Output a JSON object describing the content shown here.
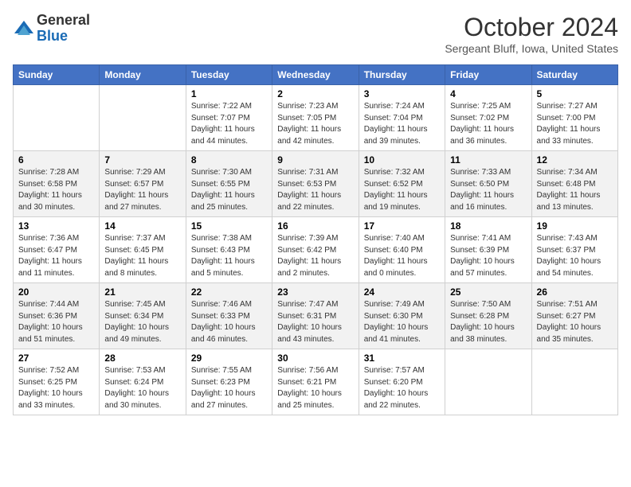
{
  "header": {
    "logo_general": "General",
    "logo_blue": "Blue",
    "month": "October 2024",
    "location": "Sergeant Bluff, Iowa, United States"
  },
  "weekdays": [
    "Sunday",
    "Monday",
    "Tuesday",
    "Wednesday",
    "Thursday",
    "Friday",
    "Saturday"
  ],
  "weeks": [
    [
      {
        "day": "",
        "detail": ""
      },
      {
        "day": "",
        "detail": ""
      },
      {
        "day": "1",
        "detail": "Sunrise: 7:22 AM\nSunset: 7:07 PM\nDaylight: 11 hours and 44 minutes."
      },
      {
        "day": "2",
        "detail": "Sunrise: 7:23 AM\nSunset: 7:05 PM\nDaylight: 11 hours and 42 minutes."
      },
      {
        "day": "3",
        "detail": "Sunrise: 7:24 AM\nSunset: 7:04 PM\nDaylight: 11 hours and 39 minutes."
      },
      {
        "day": "4",
        "detail": "Sunrise: 7:25 AM\nSunset: 7:02 PM\nDaylight: 11 hours and 36 minutes."
      },
      {
        "day": "5",
        "detail": "Sunrise: 7:27 AM\nSunset: 7:00 PM\nDaylight: 11 hours and 33 minutes."
      }
    ],
    [
      {
        "day": "6",
        "detail": "Sunrise: 7:28 AM\nSunset: 6:58 PM\nDaylight: 11 hours and 30 minutes."
      },
      {
        "day": "7",
        "detail": "Sunrise: 7:29 AM\nSunset: 6:57 PM\nDaylight: 11 hours and 27 minutes."
      },
      {
        "day": "8",
        "detail": "Sunrise: 7:30 AM\nSunset: 6:55 PM\nDaylight: 11 hours and 25 minutes."
      },
      {
        "day": "9",
        "detail": "Sunrise: 7:31 AM\nSunset: 6:53 PM\nDaylight: 11 hours and 22 minutes."
      },
      {
        "day": "10",
        "detail": "Sunrise: 7:32 AM\nSunset: 6:52 PM\nDaylight: 11 hours and 19 minutes."
      },
      {
        "day": "11",
        "detail": "Sunrise: 7:33 AM\nSunset: 6:50 PM\nDaylight: 11 hours and 16 minutes."
      },
      {
        "day": "12",
        "detail": "Sunrise: 7:34 AM\nSunset: 6:48 PM\nDaylight: 11 hours and 13 minutes."
      }
    ],
    [
      {
        "day": "13",
        "detail": "Sunrise: 7:36 AM\nSunset: 6:47 PM\nDaylight: 11 hours and 11 minutes."
      },
      {
        "day": "14",
        "detail": "Sunrise: 7:37 AM\nSunset: 6:45 PM\nDaylight: 11 hours and 8 minutes."
      },
      {
        "day": "15",
        "detail": "Sunrise: 7:38 AM\nSunset: 6:43 PM\nDaylight: 11 hours and 5 minutes."
      },
      {
        "day": "16",
        "detail": "Sunrise: 7:39 AM\nSunset: 6:42 PM\nDaylight: 11 hours and 2 minutes."
      },
      {
        "day": "17",
        "detail": "Sunrise: 7:40 AM\nSunset: 6:40 PM\nDaylight: 11 hours and 0 minutes."
      },
      {
        "day": "18",
        "detail": "Sunrise: 7:41 AM\nSunset: 6:39 PM\nDaylight: 10 hours and 57 minutes."
      },
      {
        "day": "19",
        "detail": "Sunrise: 7:43 AM\nSunset: 6:37 PM\nDaylight: 10 hours and 54 minutes."
      }
    ],
    [
      {
        "day": "20",
        "detail": "Sunrise: 7:44 AM\nSunset: 6:36 PM\nDaylight: 10 hours and 51 minutes."
      },
      {
        "day": "21",
        "detail": "Sunrise: 7:45 AM\nSunset: 6:34 PM\nDaylight: 10 hours and 49 minutes."
      },
      {
        "day": "22",
        "detail": "Sunrise: 7:46 AM\nSunset: 6:33 PM\nDaylight: 10 hours and 46 minutes."
      },
      {
        "day": "23",
        "detail": "Sunrise: 7:47 AM\nSunset: 6:31 PM\nDaylight: 10 hours and 43 minutes."
      },
      {
        "day": "24",
        "detail": "Sunrise: 7:49 AM\nSunset: 6:30 PM\nDaylight: 10 hours and 41 minutes."
      },
      {
        "day": "25",
        "detail": "Sunrise: 7:50 AM\nSunset: 6:28 PM\nDaylight: 10 hours and 38 minutes."
      },
      {
        "day": "26",
        "detail": "Sunrise: 7:51 AM\nSunset: 6:27 PM\nDaylight: 10 hours and 35 minutes."
      }
    ],
    [
      {
        "day": "27",
        "detail": "Sunrise: 7:52 AM\nSunset: 6:25 PM\nDaylight: 10 hours and 33 minutes."
      },
      {
        "day": "28",
        "detail": "Sunrise: 7:53 AM\nSunset: 6:24 PM\nDaylight: 10 hours and 30 minutes."
      },
      {
        "day": "29",
        "detail": "Sunrise: 7:55 AM\nSunset: 6:23 PM\nDaylight: 10 hours and 27 minutes."
      },
      {
        "day": "30",
        "detail": "Sunrise: 7:56 AM\nSunset: 6:21 PM\nDaylight: 10 hours and 25 minutes."
      },
      {
        "day": "31",
        "detail": "Sunrise: 7:57 AM\nSunset: 6:20 PM\nDaylight: 10 hours and 22 minutes."
      },
      {
        "day": "",
        "detail": ""
      },
      {
        "day": "",
        "detail": ""
      }
    ]
  ]
}
